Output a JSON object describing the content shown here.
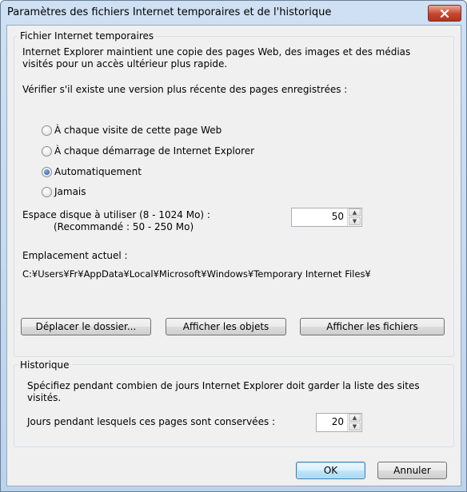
{
  "window": {
    "title": "Paramètres des fichiers Internet temporaires et de l'historique"
  },
  "temp_files": {
    "group_label": "Fichier Internet temporaires",
    "description_line1": "Internet Explorer maintient une copie des pages Web, des images et des médias",
    "description_line2": "visités pour un accès ultérieur plus rapide.",
    "check_label": "Vérifier s'il existe une version plus récente des pages enregistrées :",
    "options": [
      {
        "label": "À chaque visite de cette page Web",
        "checked": false
      },
      {
        "label": "À chaque démarrage de Internet Explorer",
        "checked": false
      },
      {
        "label": "Automatiquement",
        "checked": true
      },
      {
        "label": "Jamais",
        "checked": false
      }
    ],
    "disk_space_label": "Espace disque à utiliser (8 - 1024 Mo) :",
    "disk_space_recommended": "(Recommandé : 50 - 250 Mo)",
    "disk_space_value": "50",
    "location_label": "Emplacement actuel :",
    "location_path": "C:¥Users¥Fr¥AppData¥Local¥Microsoft¥Windows¥Temporary Internet Files¥",
    "buttons": {
      "move_folder": "Déplacer le dossier...",
      "view_objects": "Afficher les objets",
      "view_files": "Afficher les fichiers"
    }
  },
  "history": {
    "group_label": "Historique",
    "description_line1": "Spécifiez pendant combien de jours Internet Explorer doit garder la liste des sites",
    "description_line2": "visités.",
    "days_label": "Jours pendant lesquels ces pages sont conservées :",
    "days_value": "20"
  },
  "footer": {
    "ok": "OK",
    "cancel": "Annuler"
  }
}
